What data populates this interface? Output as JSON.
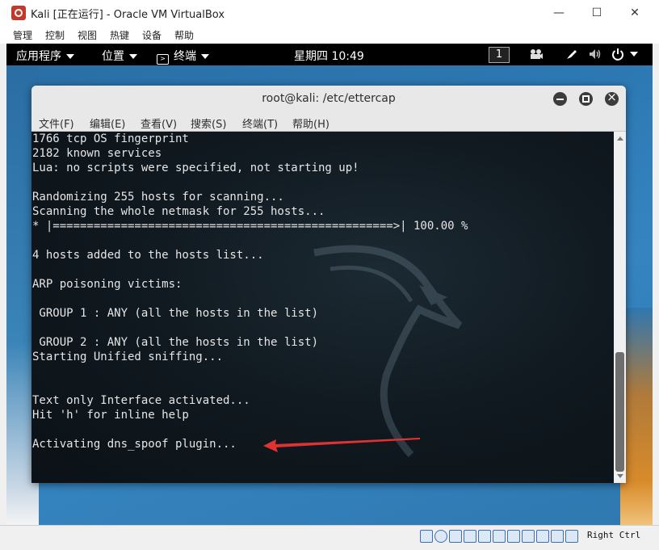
{
  "host": {
    "title": "Kali [正在运行] - Oracle VM VirtualBox",
    "menu": [
      "管理",
      "控制",
      "视图",
      "热键",
      "设备",
      "帮助"
    ],
    "controls": [
      "—",
      "☐",
      "✕"
    ],
    "host_key": "Right Ctrl"
  },
  "panel": {
    "apps": "应用程序",
    "places": "位置",
    "terminal": "终端",
    "clock": "星期四 10:49",
    "workspace": "1"
  },
  "terminal": {
    "title": "root@kali: /etc/ettercap",
    "menu": [
      "文件(F)",
      "编辑(E)",
      "查看(V)",
      "搜索(S)",
      "终端(T)",
      "帮助(H)"
    ],
    "lines": [
      "1766 tcp OS fingerprint",
      "2182 known services",
      "Lua: no scripts were specified, not starting up!",
      "",
      "Randomizing 255 hosts for scanning...",
      "Scanning the whole netmask for 255 hosts...",
      "* |==================================================>| 100.00 %",
      "",
      "4 hosts added to the hosts list...",
      "",
      "ARP poisoning victims:",
      "",
      " GROUP 1 : ANY (all the hosts in the list)",
      "",
      " GROUP 2 : ANY (all the hosts in the list)",
      "Starting Unified sniffing...",
      "",
      "",
      "Text only Interface activated...",
      "Hit 'h' for inline help",
      "",
      "Activating dns_spoof plugin..."
    ]
  },
  "colors": {
    "terminal_bg": "#0f171d",
    "annotation_arrow": "#e03232",
    "panel_bg": "#000000"
  }
}
